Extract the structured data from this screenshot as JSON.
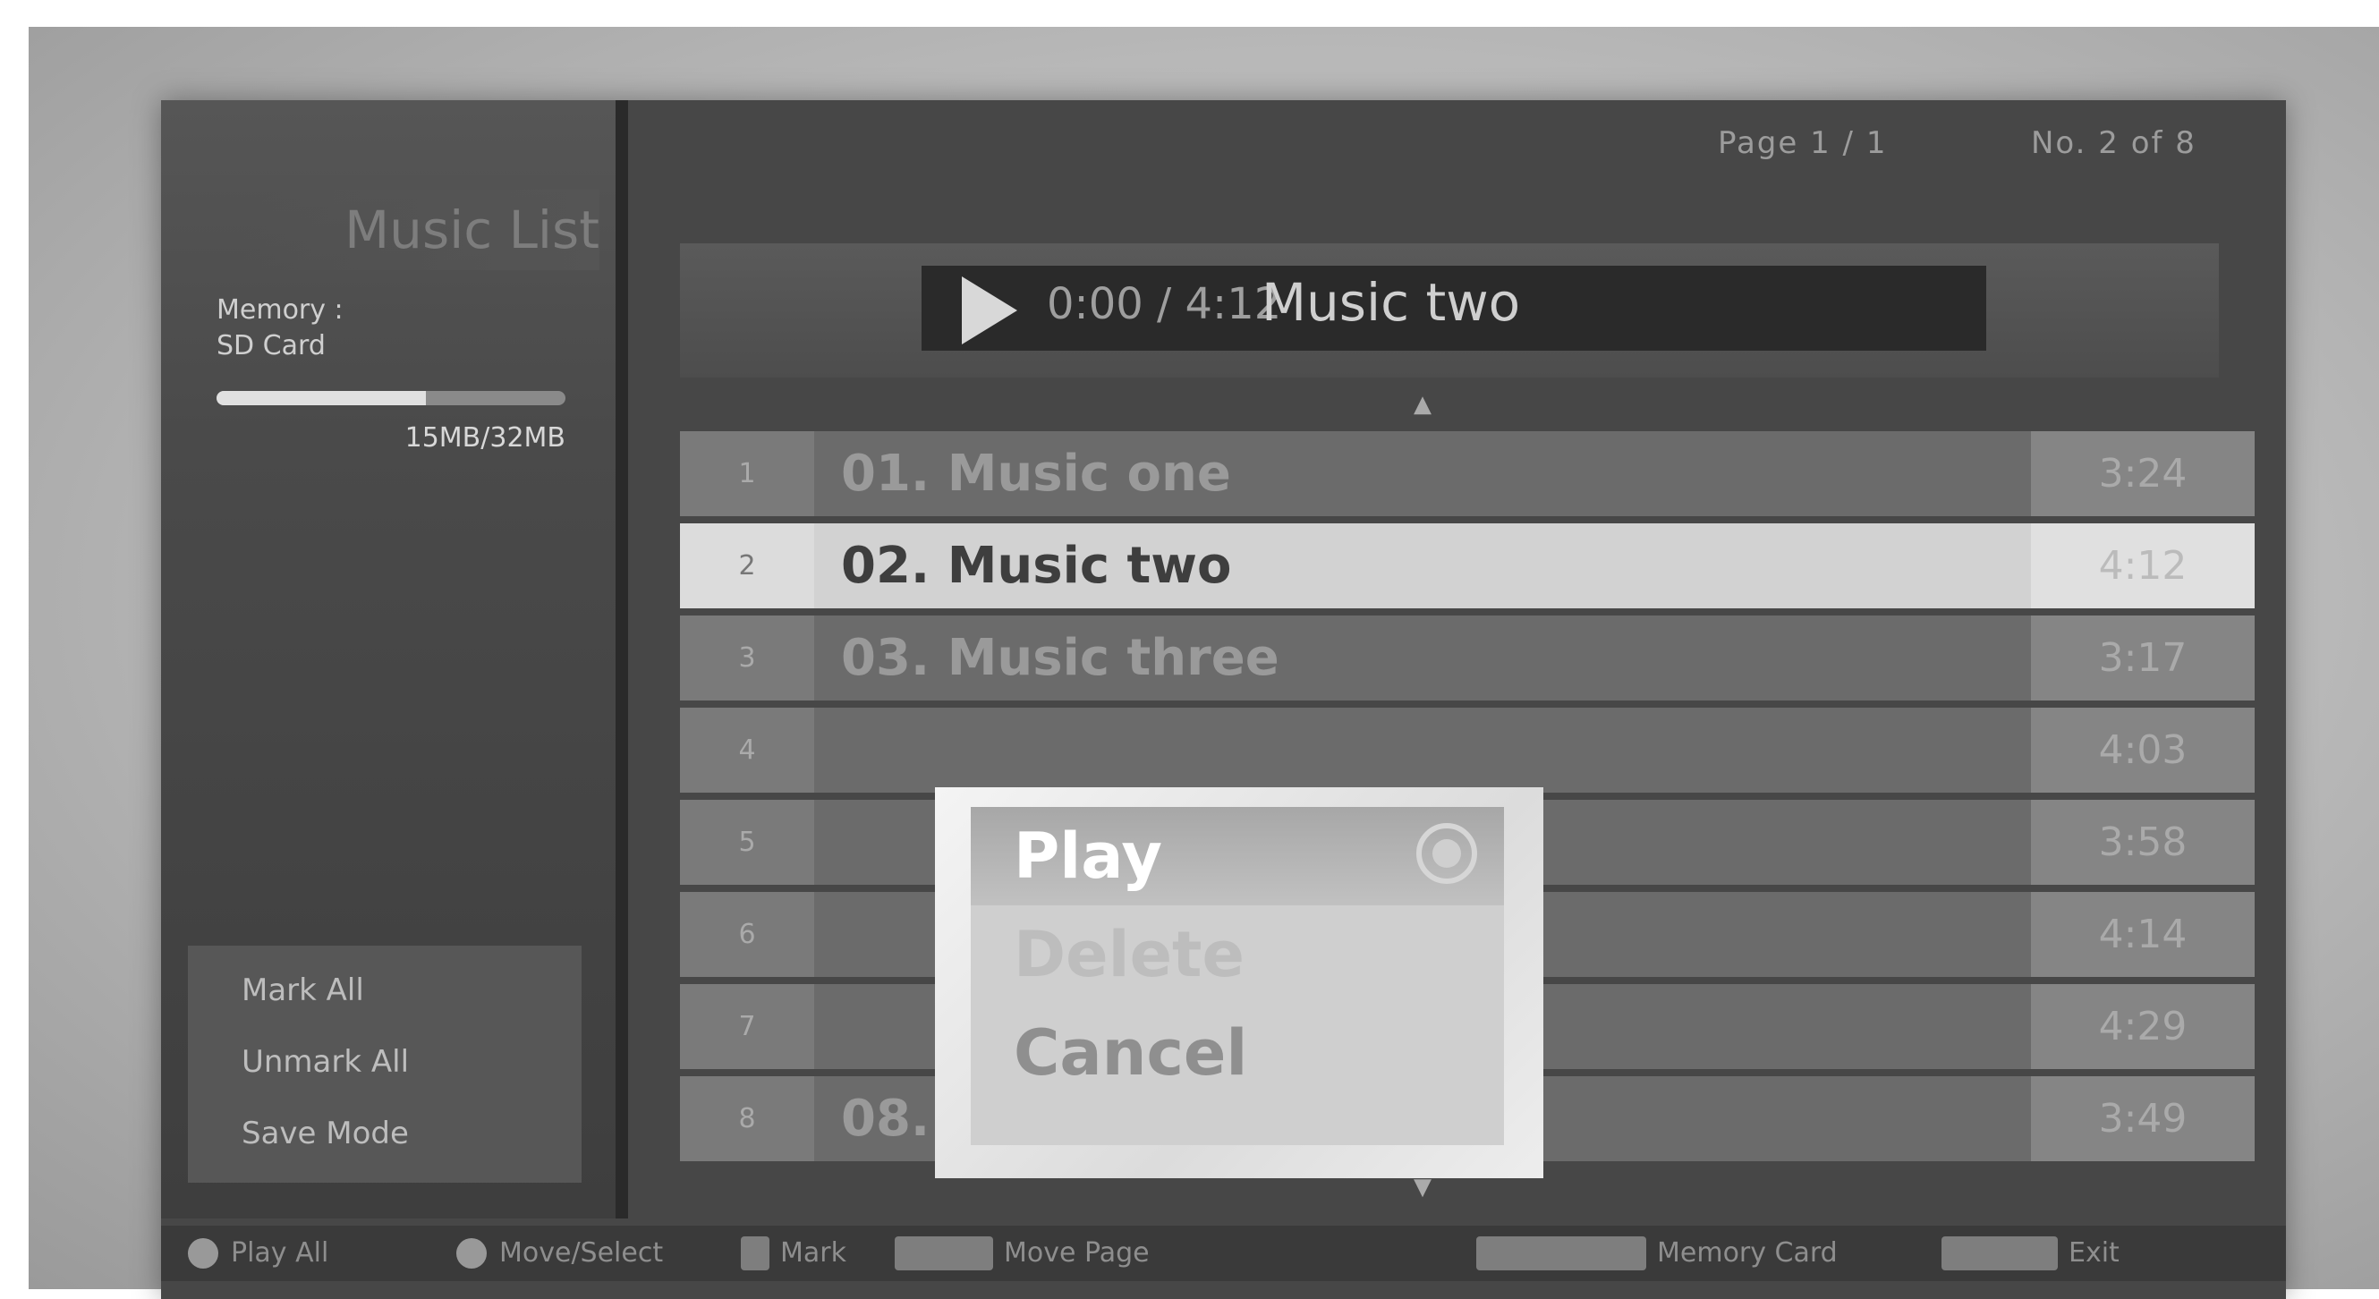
{
  "left_panel": {
    "heading": "Music List",
    "memory_label_line1": "Memory :",
    "memory_label_line2": "SD Card",
    "memory_used_fraction": 0.6,
    "memory_percent_text": "15MB/32MB",
    "options": [
      "Mark All",
      "Unmark All",
      "Save Mode"
    ]
  },
  "header": {
    "page_info": "Page 1 / 1",
    "track_count": "No. 2 of 8"
  },
  "now_playing": {
    "time": "0:00 / 4:12",
    "title": "Music two"
  },
  "tracks": [
    {
      "index": "1",
      "title": "01. Music one",
      "duration": "3:24"
    },
    {
      "index": "2",
      "title": "02. Music two",
      "duration": "4:12"
    },
    {
      "index": "3",
      "title": "03. Music three",
      "duration": "3:17"
    },
    {
      "index": "4",
      "title": "",
      "duration": "4:03"
    },
    {
      "index": "5",
      "title": "",
      "duration": "3:58"
    },
    {
      "index": "6",
      "title": "",
      "duration": "4:14"
    },
    {
      "index": "7",
      "title": "",
      "duration": "4:29"
    },
    {
      "index": "8",
      "title": "08. Music eight",
      "duration": "3:49"
    }
  ],
  "popup_menu": {
    "play_label": "Play",
    "delete_label": "Delete",
    "cancel_label": "Cancel"
  },
  "bottom_bar": {
    "hint1": "Play All",
    "hint2": "Move/Select",
    "hint3": "Mark",
    "hint4": "Move Page",
    "hint5": "Memory Card",
    "hint6": "Exit"
  }
}
